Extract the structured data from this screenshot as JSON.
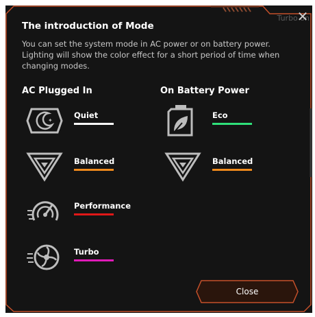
{
  "dialog": {
    "ghost_text": "Turbo on",
    "title": "The introduction of Mode",
    "intro": "You can set the system mode in AC power or on battery power. Lighting will show the color effect for a short period of time when changing modes.",
    "close_label": "Close"
  },
  "ac": {
    "heading": "AC Plugged In",
    "modes": [
      {
        "label": "Quiet",
        "color": "#ffffff",
        "icon": "quiet-mode-icon"
      },
      {
        "label": "Balanced",
        "color": "#f08a1c",
        "icon": "balanced-mode-icon"
      },
      {
        "label": "Performance",
        "color": "#e01818",
        "icon": "performance-mode-icon"
      },
      {
        "label": "Turbo",
        "color": "#e01ab8",
        "icon": "turbo-mode-icon"
      }
    ]
  },
  "battery": {
    "heading": "On Battery Power",
    "modes": [
      {
        "label": "Eco",
        "color": "#2fe07a",
        "icon": "eco-mode-icon"
      },
      {
        "label": "Balanced",
        "color": "#f08a1c",
        "icon": "balanced-mode-icon"
      }
    ]
  },
  "colors": {
    "accent": "#c4502a",
    "background": "#141414"
  }
}
